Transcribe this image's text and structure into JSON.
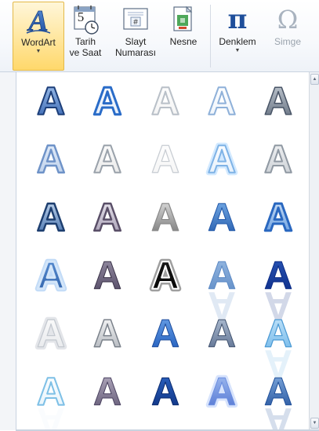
{
  "ribbon": {
    "buttons": [
      {
        "id": "wordart",
        "label": "WordArt",
        "has_dropdown": true,
        "state": "active",
        "icon": "wordart-icon"
      },
      {
        "id": "datetime",
        "label_line1": "Tarih",
        "label_line2": "ve Saat",
        "icon": "calendar-clock-icon"
      },
      {
        "id": "slidenumber",
        "label_line1": "Slayt",
        "label_line2": "Numarası",
        "icon": "slide-number-icon"
      },
      {
        "id": "object",
        "label": "Nesne",
        "icon": "object-icon"
      },
      {
        "id": "equation",
        "label": "Denklem",
        "has_dropdown": true,
        "icon": "pi-icon",
        "glyph": "π"
      },
      {
        "id": "symbol",
        "label": "Simge",
        "state": "disabled",
        "icon": "omega-icon",
        "glyph": "Ω"
      }
    ],
    "calendar_number": "5",
    "slide_number_glyph": "#",
    "caret": "▼"
  },
  "gallery": {
    "glyph": "A",
    "rows": 6,
    "cols": 5,
    "styles": [
      [
        "fill-blue-gradient-outline",
        "blue-outline",
        "white-gray-outline",
        "white-blue-outline",
        "gray-bevel"
      ],
      [
        "light-blue-double-outline",
        "white-gray-bevel",
        "white-light",
        "light-blue-glow",
        "white-gray-shadow"
      ],
      [
        "blue-steel-outline",
        "purple-gray-outline",
        "gray-metal",
        "blue-gradient",
        "blue-double-outline"
      ],
      [
        "blue-glow",
        "purple-gray-fill",
        "black-white-outline",
        "blue-reflection",
        "dark-blue-reflection"
      ],
      [
        "white-shadow",
        "white-gray-chrome",
        "blue-3d",
        "gray-blue-3d",
        "light-blue-reflection"
      ],
      [
        "light-blue-outline-reflection",
        "purple-gray-3d",
        "blue-dark-3d",
        "blue-soft-glow",
        "blue-gradient-reflection"
      ]
    ]
  },
  "scrollbar": {
    "up": "▲",
    "down": "▼"
  },
  "colors": {
    "accent": "#ffd86b",
    "ribbon_border": "#c9d3e0"
  }
}
